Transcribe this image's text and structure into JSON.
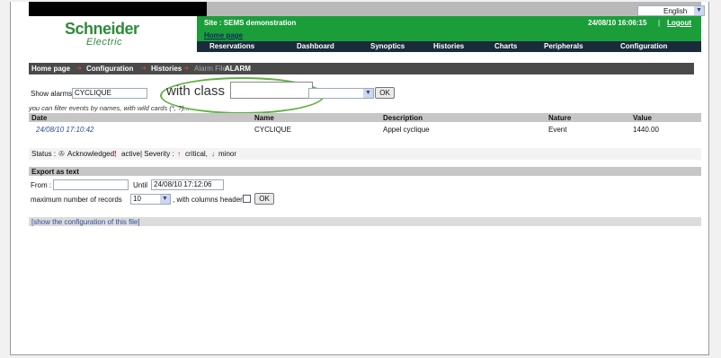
{
  "language": {
    "selected": "English"
  },
  "logo": {
    "line1": "Schneider",
    "line2": "Electric"
  },
  "header": {
    "site": "Site : SEMS demonstration",
    "home_link": "Home page",
    "datetime": "24/08/10 16:06:15",
    "separator": "|",
    "logout": "Logout"
  },
  "menu": [
    "Reservations",
    "Dashboard",
    "Synoptics",
    "Histories",
    "Charts",
    "Peripherals",
    "Configuration"
  ],
  "breadcrumb": {
    "home": "Home page",
    "configuration": "Configuration",
    "histories": "Histories",
    "file_label": "Alarm File",
    "file_name": "ALARM"
  },
  "filter": {
    "show_alarms_label": "Show alarms",
    "name_value": "CYCLIQUE",
    "with_class_label": "with class",
    "class_value": "",
    "ok": "OK",
    "hint": "you can filter events by names, with wild cards (*, ?)..."
  },
  "table": {
    "columns": [
      "Date",
      "Name",
      "Description",
      "Nature",
      "Value"
    ],
    "rows": [
      {
        "date": "24/08/10 17:10:42",
        "name": "CYCLIQUE",
        "description": "Appel cyclique",
        "nature": "Event",
        "value": "1440.00"
      }
    ]
  },
  "status_legend": {
    "status_label": "Status :",
    "acknowledged": "Acknowledged,",
    "active": "active",
    "severity_label": "| Severity :",
    "critical": "critical,",
    "minor": "minor"
  },
  "export": {
    "title": "Export as text",
    "from_label": "From :",
    "from_value": "",
    "until_label": "Until",
    "until_value": "24/08/10 17:12:06",
    "max_records_label": "maximum number of records",
    "max_records_value": "10",
    "columns_header_label": ", with columns header",
    "ok": "OK"
  },
  "config_link": "[show the configuration of this file]",
  "colors": {
    "green_header": "#1b9e3a",
    "menu_bg": "#1a2c3c",
    "oval": "#5fb340",
    "logo": "#2e8b3a"
  }
}
